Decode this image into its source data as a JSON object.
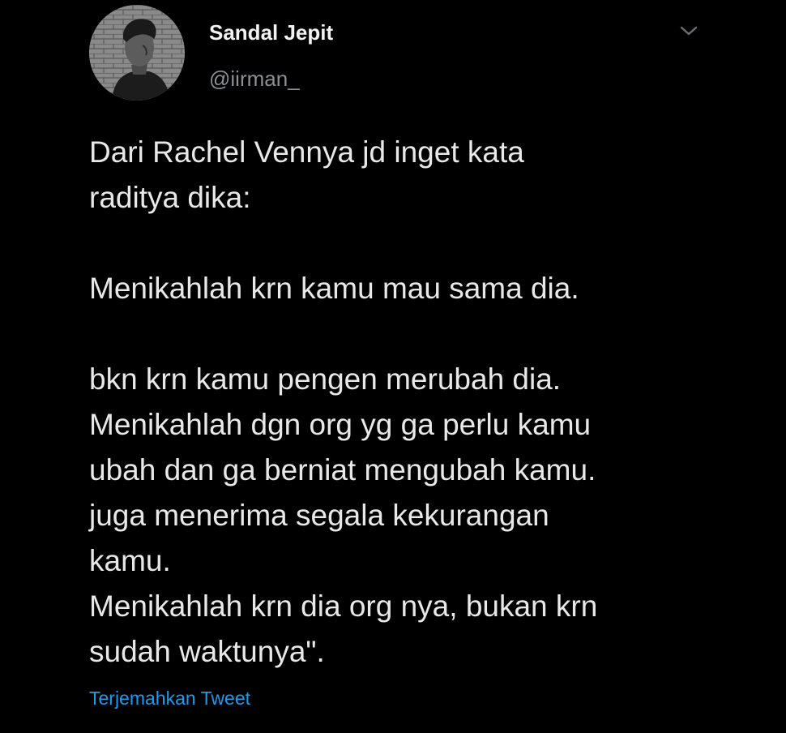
{
  "author": {
    "display_name": "Sandal Jepit",
    "handle": "@iirman_",
    "avatar_icon": "user-avatar"
  },
  "menu": {
    "icon": "chevron-down-icon"
  },
  "tweet": {
    "lines": [
      "Dari Rachel Vennya jd inget kata",
      "raditya dika:",
      "",
      "Menikahlah krn kamu mau sama dia.",
      "",
      "bkn krn kamu pengen merubah dia.",
      "Menikahlah dgn org yg ga perlu kamu",
      "ubah dan ga berniat mengubah kamu.",
      "juga menerima segala kekurangan",
      "kamu.",
      "Menikahlah krn dia org nya, bukan krn",
      "sudah waktunya\"."
    ],
    "translate_label": "Terjemahkan Tweet"
  },
  "colors": {
    "background": "#000000",
    "text": "#e8e8e8",
    "secondary": "#8b9096",
    "link": "#1d9bf0"
  }
}
